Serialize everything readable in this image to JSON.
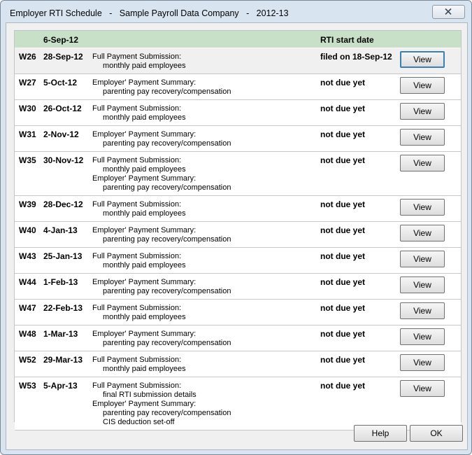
{
  "window": {
    "title": "Employer RTI Schedule   -   Sample Payroll Data Company   -   2012-13"
  },
  "header": {
    "date": "6-Sep-12",
    "status_label": "RTI start date"
  },
  "rows": [
    {
      "week": "W26",
      "date": "28-Sep-12",
      "status": "filed on 18-Sep-12",
      "view": "View",
      "lines": [
        {
          "text": "Full Payment Submission:",
          "indent": false
        },
        {
          "text": "monthly paid employees",
          "indent": true
        }
      ]
    },
    {
      "week": "W27",
      "date": "5-Oct-12",
      "status": "not due yet",
      "view": "View",
      "lines": [
        {
          "text": "Employer' Payment Summary:",
          "indent": false
        },
        {
          "text": "parenting pay recovery/compensation",
          "indent": true
        }
      ]
    },
    {
      "week": "W30",
      "date": "26-Oct-12",
      "status": "not due yet",
      "view": "View",
      "lines": [
        {
          "text": "Full Payment Submission:",
          "indent": false
        },
        {
          "text": "monthly paid employees",
          "indent": true
        }
      ]
    },
    {
      "week": "W31",
      "date": "2-Nov-12",
      "status": "not due yet",
      "view": "View",
      "lines": [
        {
          "text": "Employer' Payment Summary:",
          "indent": false
        },
        {
          "text": "parenting pay recovery/compensation",
          "indent": true
        }
      ]
    },
    {
      "week": "W35",
      "date": "30-Nov-12",
      "status": "not due yet",
      "view": "View",
      "lines": [
        {
          "text": "Full Payment Submission:",
          "indent": false
        },
        {
          "text": "monthly paid employees",
          "indent": true
        },
        {
          "text": "Employer' Payment Summary:",
          "indent": false
        },
        {
          "text": "parenting pay recovery/compensation",
          "indent": true
        }
      ]
    },
    {
      "week": "W39",
      "date": "28-Dec-12",
      "status": "not due yet",
      "view": "View",
      "lines": [
        {
          "text": "Full Payment Submission:",
          "indent": false
        },
        {
          "text": "monthly paid employees",
          "indent": true
        }
      ]
    },
    {
      "week": "W40",
      "date": "4-Jan-13",
      "status": "not due yet",
      "view": "View",
      "lines": [
        {
          "text": "Employer' Payment Summary:",
          "indent": false
        },
        {
          "text": "parenting pay recovery/compensation",
          "indent": true
        }
      ]
    },
    {
      "week": "W43",
      "date": "25-Jan-13",
      "status": "not due yet",
      "view": "View",
      "lines": [
        {
          "text": "Full Payment Submission:",
          "indent": false
        },
        {
          "text": "monthly paid employees",
          "indent": true
        }
      ]
    },
    {
      "week": "W44",
      "date": "1-Feb-13",
      "status": "not due yet",
      "view": "View",
      "lines": [
        {
          "text": "Employer' Payment Summary:",
          "indent": false
        },
        {
          "text": "parenting pay recovery/compensation",
          "indent": true
        }
      ]
    },
    {
      "week": "W47",
      "date": "22-Feb-13",
      "status": "not due yet",
      "view": "View",
      "lines": [
        {
          "text": "Full Payment Submission:",
          "indent": false
        },
        {
          "text": "monthly paid employees",
          "indent": true
        }
      ]
    },
    {
      "week": "W48",
      "date": "1-Mar-13",
      "status": "not due yet",
      "view": "View",
      "lines": [
        {
          "text": "Employer' Payment Summary:",
          "indent": false
        },
        {
          "text": "parenting pay recovery/compensation",
          "indent": true
        }
      ]
    },
    {
      "week": "W52",
      "date": "29-Mar-13",
      "status": "not due yet",
      "view": "View",
      "lines": [
        {
          "text": "Full Payment Submission:",
          "indent": false
        },
        {
          "text": "monthly paid employees",
          "indent": true
        }
      ]
    },
    {
      "week": "W53",
      "date": "5-Apr-13",
      "status": "not due yet",
      "view": "View",
      "lines": [
        {
          "text": "Full Payment Submission:",
          "indent": false
        },
        {
          "text": "final RTI submission details",
          "indent": true
        },
        {
          "text": "Employer' Payment Summary:",
          "indent": false
        },
        {
          "text": "parenting pay recovery/compensation",
          "indent": true
        },
        {
          "text": "CIS deduction set-off",
          "indent": true
        }
      ]
    }
  ],
  "footer": {
    "help_label": "Help",
    "ok_label": "OK"
  },
  "icons": {
    "close": "close-icon"
  },
  "colors": {
    "header_bg": "#c8e0c8",
    "default_button_border": "#3c7fb1"
  }
}
